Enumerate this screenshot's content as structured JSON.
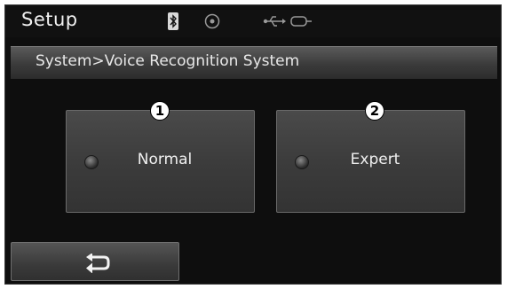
{
  "header": {
    "title": "Setup",
    "icons": [
      "bluetooth-icon",
      "disc-icon",
      "usb-icon",
      "aux-icon"
    ]
  },
  "breadcrumb": "System>Voice Recognition System",
  "options": [
    {
      "label": "Normal",
      "callout": "1",
      "selected": false
    },
    {
      "label": "Expert",
      "callout": "2",
      "selected": false
    }
  ],
  "footer": {
    "back_icon": "back-arrow-icon"
  },
  "colors": {
    "background": "#0e0e0e",
    "button": "#3c3c3c",
    "text": "#f0f0f0"
  }
}
